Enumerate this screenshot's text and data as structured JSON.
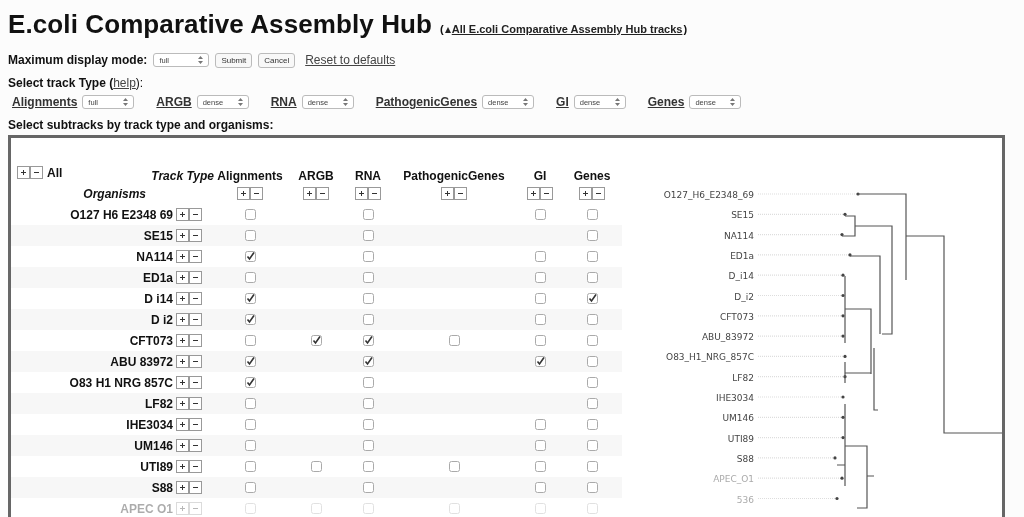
{
  "page_title": "E.coli Comparative Assembly Hub",
  "back_link": {
    "open": "(",
    "label": "All E.coli Comparative Assembly Hub tracks",
    "close": ")"
  },
  "display_mode": {
    "label": "Maximum display mode:",
    "value": "full",
    "buttons": [
      "Submit",
      "Cancel"
    ],
    "reset_link": "Reset to defaults"
  },
  "track_type_heading": {
    "label": "Select track Type (",
    "help_link": "help",
    "after": "):"
  },
  "track_types": [
    {
      "name": "Alignments",
      "mode": "full"
    },
    {
      "name": "ARGB",
      "mode": "dense"
    },
    {
      "name": "RNA",
      "mode": "dense"
    },
    {
      "name": "PathogenicGenes",
      "mode": "dense"
    },
    {
      "name": "GI",
      "mode": "dense"
    },
    {
      "name": "Genes",
      "mode": "dense"
    }
  ],
  "subtracks_heading": "Select subtracks by track type and organisms:",
  "matrix": {
    "all_label": "All",
    "track_type_label": "Track Type",
    "organisms_label": "Organisms",
    "columns": [
      "Alignments",
      "ARGB",
      "RNA",
      "PathogenicGenes",
      "GI",
      "Genes"
    ],
    "rows": [
      {
        "name": "O127 H6 E2348 69",
        "faded": false,
        "cells": [
          {
            "kind": "checkbox",
            "checked": false
          },
          {
            "kind": "empty"
          },
          {
            "kind": "checkbox",
            "checked": false
          },
          {
            "kind": "empty"
          },
          {
            "kind": "checkbox",
            "checked": false
          },
          {
            "kind": "checkbox",
            "checked": false
          }
        ]
      },
      {
        "name": "SE15",
        "faded": false,
        "cells": [
          {
            "kind": "checkbox",
            "checked": false
          },
          {
            "kind": "empty"
          },
          {
            "kind": "checkbox",
            "checked": false
          },
          {
            "kind": "empty"
          },
          {
            "kind": "empty"
          },
          {
            "kind": "checkbox",
            "checked": false
          }
        ]
      },
      {
        "name": "NA114",
        "faded": false,
        "cells": [
          {
            "kind": "checkbox",
            "checked": true
          },
          {
            "kind": "empty"
          },
          {
            "kind": "checkbox",
            "checked": false
          },
          {
            "kind": "empty"
          },
          {
            "kind": "checkbox",
            "checked": false
          },
          {
            "kind": "checkbox",
            "checked": false
          }
        ]
      },
      {
        "name": "ED1a",
        "faded": false,
        "cells": [
          {
            "kind": "checkbox",
            "checked": false
          },
          {
            "kind": "empty"
          },
          {
            "kind": "checkbox",
            "checked": false
          },
          {
            "kind": "empty"
          },
          {
            "kind": "checkbox",
            "checked": false
          },
          {
            "kind": "checkbox",
            "checked": false
          }
        ]
      },
      {
        "name": "D i14",
        "faded": false,
        "cells": [
          {
            "kind": "checkbox",
            "checked": true
          },
          {
            "kind": "empty"
          },
          {
            "kind": "checkbox",
            "checked": false
          },
          {
            "kind": "empty"
          },
          {
            "kind": "checkbox",
            "checked": false
          },
          {
            "kind": "checkbox",
            "checked": true
          }
        ]
      },
      {
        "name": "D i2",
        "faded": false,
        "cells": [
          {
            "kind": "checkbox",
            "checked": true
          },
          {
            "kind": "empty"
          },
          {
            "kind": "checkbox",
            "checked": false
          },
          {
            "kind": "empty"
          },
          {
            "kind": "checkbox",
            "checked": false
          },
          {
            "kind": "checkbox",
            "checked": false
          }
        ]
      },
      {
        "name": "CFT073",
        "faded": false,
        "cells": [
          {
            "kind": "checkbox",
            "checked": false
          },
          {
            "kind": "checkbox",
            "checked": true
          },
          {
            "kind": "checkbox",
            "checked": true
          },
          {
            "kind": "checkbox",
            "checked": false
          },
          {
            "kind": "checkbox",
            "checked": false
          },
          {
            "kind": "checkbox",
            "checked": false
          }
        ]
      },
      {
        "name": "ABU 83972",
        "faded": false,
        "cells": [
          {
            "kind": "checkbox",
            "checked": true
          },
          {
            "kind": "empty"
          },
          {
            "kind": "checkbox",
            "checked": true
          },
          {
            "kind": "empty"
          },
          {
            "kind": "checkbox",
            "checked": true
          },
          {
            "kind": "checkbox",
            "checked": false
          }
        ]
      },
      {
        "name": "O83 H1 NRG 857C",
        "faded": false,
        "cells": [
          {
            "kind": "checkbox",
            "checked": true
          },
          {
            "kind": "empty"
          },
          {
            "kind": "checkbox",
            "checked": false
          },
          {
            "kind": "empty"
          },
          {
            "kind": "empty"
          },
          {
            "kind": "checkbox",
            "checked": false
          }
        ]
      },
      {
        "name": "LF82",
        "faded": false,
        "cells": [
          {
            "kind": "checkbox",
            "checked": false
          },
          {
            "kind": "empty"
          },
          {
            "kind": "checkbox",
            "checked": false
          },
          {
            "kind": "empty"
          },
          {
            "kind": "empty"
          },
          {
            "kind": "checkbox",
            "checked": false
          }
        ]
      },
      {
        "name": "IHE3034",
        "faded": false,
        "cells": [
          {
            "kind": "checkbox",
            "checked": false
          },
          {
            "kind": "empty"
          },
          {
            "kind": "checkbox",
            "checked": false
          },
          {
            "kind": "empty"
          },
          {
            "kind": "checkbox",
            "checked": false
          },
          {
            "kind": "checkbox",
            "checked": false
          }
        ]
      },
      {
        "name": "UM146",
        "faded": false,
        "cells": [
          {
            "kind": "checkbox",
            "checked": false
          },
          {
            "kind": "empty"
          },
          {
            "kind": "checkbox",
            "checked": false
          },
          {
            "kind": "empty"
          },
          {
            "kind": "checkbox",
            "checked": false
          },
          {
            "kind": "checkbox",
            "checked": false
          }
        ]
      },
      {
        "name": "UTI89",
        "faded": false,
        "cells": [
          {
            "kind": "checkbox",
            "checked": false
          },
          {
            "kind": "checkbox",
            "checked": false
          },
          {
            "kind": "checkbox",
            "checked": false
          },
          {
            "kind": "checkbox",
            "checked": false
          },
          {
            "kind": "checkbox",
            "checked": false
          },
          {
            "kind": "checkbox",
            "checked": false
          }
        ]
      },
      {
        "name": "S88",
        "faded": false,
        "cells": [
          {
            "kind": "checkbox",
            "checked": false
          },
          {
            "kind": "empty"
          },
          {
            "kind": "checkbox",
            "checked": false
          },
          {
            "kind": "empty"
          },
          {
            "kind": "checkbox",
            "checked": false
          },
          {
            "kind": "checkbox",
            "checked": false
          }
        ]
      },
      {
        "name": "APEC O1",
        "faded": true,
        "cells": [
          {
            "kind": "checkbox",
            "checked": false
          },
          {
            "kind": "checkbox",
            "checked": false
          },
          {
            "kind": "checkbox",
            "checked": false
          },
          {
            "kind": "checkbox",
            "checked": false
          },
          {
            "kind": "checkbox",
            "checked": false
          },
          {
            "kind": "checkbox",
            "checked": false
          }
        ]
      }
    ]
  },
  "tree": {
    "leaves": [
      {
        "label": "O127_H6_E2348_69",
        "faded": false
      },
      {
        "label": "SE15",
        "faded": false
      },
      {
        "label": "NA114",
        "faded": false
      },
      {
        "label": "ED1a",
        "faded": false
      },
      {
        "label": "D_i14",
        "faded": false
      },
      {
        "label": "D_i2",
        "faded": false
      },
      {
        "label": "CFT073",
        "faded": false
      },
      {
        "label": "ABU_83972",
        "faded": false
      },
      {
        "label": "O83_H1_NRG_857C",
        "faded": false
      },
      {
        "label": "LF82",
        "faded": false
      },
      {
        "label": "IHE3034",
        "faded": false
      },
      {
        "label": "UM146",
        "faded": false
      },
      {
        "label": "UTI89",
        "faded": false
      },
      {
        "label": "S88",
        "faded": false
      },
      {
        "label": "APEC_O1",
        "faded": true
      },
      {
        "label": "536",
        "faded": true
      }
    ]
  }
}
